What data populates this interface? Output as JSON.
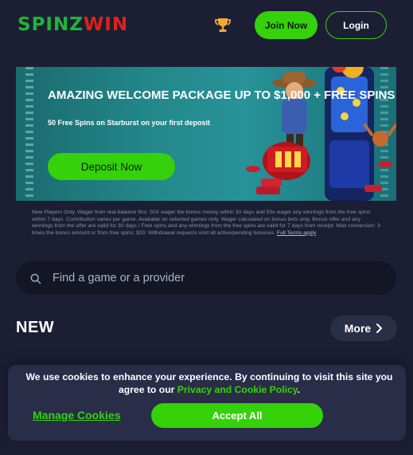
{
  "header": {
    "logo_part1": "SPINZ",
    "logo_part2": "WIN",
    "join_label": "Join Now",
    "login_label": "Login",
    "trophy_icon": "trophy-icon"
  },
  "banner": {
    "title": "AMAZING WELCOME PACKAGE UP TO $1,000 + FREE SPINS",
    "subtitle": "50 Free Spins on Starburst on your first deposit",
    "deposit_label": "Deposit Now",
    "disclaimer": "New Players Only. Wager from real balance first. 50X wager the bonus money within 30 days and 50x wager any winnings from the free spins within 7 days. Contribution varies per game. Available on selected games only. Wager calculated on bonus bets only. Bonus offer and any winnings from the offer are valid for 30 days / Free spins and any winnings from the free spins are valid for 7 days from receipt. Max conversion: 3 times the bonus amount or from free spins: $20. Withdrawal requests void all active/pending bonuses.",
    "terms_label": "Full Terms apply"
  },
  "search": {
    "placeholder": "Find a game or a provider",
    "icon": "search-icon"
  },
  "section": {
    "title": "NEW",
    "more_label": "More"
  },
  "cookie": {
    "text_before": "We use cookies to enhance your experience. By continuing to visit this site you agree to our ",
    "link": "Privacy and Cookie Policy",
    "text_after": ".",
    "manage_label": "Manage Cookies",
    "accept_label": "Accept All"
  },
  "colors": {
    "background": "#1c1f33",
    "accent_green": "#35d20b",
    "logo_red": "#e0201b",
    "banner_teal": "#23878a"
  }
}
